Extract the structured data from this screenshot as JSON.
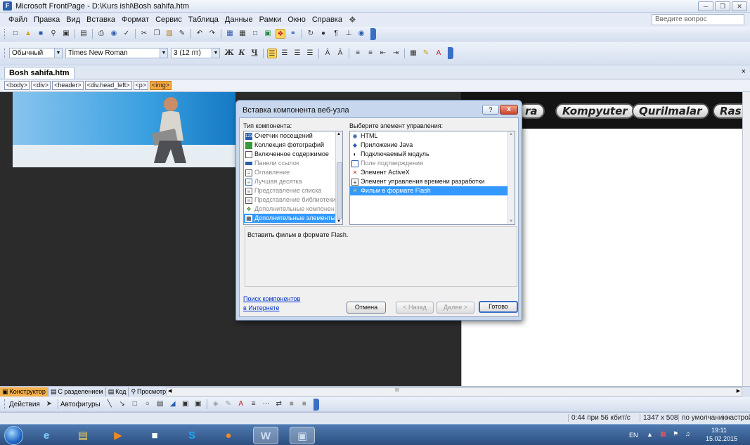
{
  "window": {
    "title": "Microsoft FrontPage - D:\\Kurs ishi\\Bosh sahifa.htm",
    "app_icon": "frontpage-icon",
    "buttons": [
      "minimize-icon",
      "restore-icon",
      "close-icon"
    ]
  },
  "menu": {
    "items": [
      "Файл",
      "Правка",
      "Вид",
      "Вставка",
      "Формат",
      "Сервис",
      "Таблица",
      "Данные",
      "Рамки",
      "Окно",
      "Справка"
    ],
    "ask_placeholder": "Введите вопрос"
  },
  "format_toolbar": {
    "style": "Обычный",
    "font": "Times New Roman",
    "size": "3 (12 пт)",
    "bold": "Ж",
    "italic": "К",
    "underline": "Ч"
  },
  "document": {
    "tab": "Bosh sahifa.htm",
    "close": "×"
  },
  "tags": [
    "<body>",
    "<div>",
    "<header>",
    "<div.head_left>",
    "<p>",
    "<img>"
  ],
  "page": {
    "nav": [
      "ra",
      "Kompyuter",
      "Qurilmalar",
      "Ras"
    ]
  },
  "dialog": {
    "title": "Вставка компонента веб-узла",
    "help": "?",
    "close": "x",
    "type_label": "Тип компонента:",
    "type_items": [
      {
        "label": "Счетчик посещений",
        "icon": "counter-icon",
        "state": "normal"
      },
      {
        "label": "Коллекция фотографий",
        "icon": "photo-gallery-icon",
        "state": "normal"
      },
      {
        "label": "Включенное содержимое",
        "icon": "included-content-icon",
        "state": "normal"
      },
      {
        "label": "Панели ссылок",
        "icon": "link-bar-icon",
        "state": "gray"
      },
      {
        "label": "Оглавление",
        "icon": "toc-icon",
        "state": "gray"
      },
      {
        "label": "Лучшая десятка",
        "icon": "top-ten-icon",
        "state": "gray"
      },
      {
        "label": "Представление списка",
        "icon": "list-view-icon",
        "state": "gray"
      },
      {
        "label": "Представление библиотеки",
        "icon": "library-view-icon",
        "state": "gray"
      },
      {
        "label": "Дополнительные компонен",
        "icon": "additional-components-icon",
        "state": "gray"
      },
      {
        "label": "Дополнительные элементы",
        "icon": "advanced-controls-icon",
        "state": "selected"
      }
    ],
    "control_label": "Выберите элемент управления:",
    "control_items": [
      {
        "label": "HTML",
        "icon": "html-icon",
        "state": "normal"
      },
      {
        "label": "Приложение Java",
        "icon": "java-icon",
        "state": "normal"
      },
      {
        "label": "Подключаемый модуль",
        "icon": "plugin-icon",
        "state": "normal"
      },
      {
        "label": "Поле подтверждения",
        "icon": "confirmation-field-icon",
        "state": "gray"
      },
      {
        "label": "Элемент ActiveX",
        "icon": "activex-icon",
        "state": "normal"
      },
      {
        "label": "Элемент управления времени разработки",
        "icon": "design-time-control-icon",
        "state": "normal"
      },
      {
        "label": "Фильм в формате Flash",
        "icon": "flash-icon",
        "state": "selected"
      }
    ],
    "description": "Вставить фильм в формате Flash.",
    "search_link_line1": "Поиск компонентов",
    "search_link_line2": "в Интернете",
    "cancel": "Отмена",
    "back": "< Назад",
    "next": "Далее >",
    "finish": "Готово"
  },
  "view_tabs": [
    {
      "label": "Конструктор",
      "icon": "design-view-icon",
      "active": true
    },
    {
      "label": "С разделением",
      "icon": "split-view-icon",
      "active": false
    },
    {
      "label": "Код",
      "icon": "code-view-icon",
      "active": false
    },
    {
      "label": "Просмотр",
      "icon": "preview-icon",
      "active": false
    }
  ],
  "scroll_mark": "III",
  "drawing_toolbar": {
    "actions": "Действия",
    "autoshapes": "Автофигуры"
  },
  "status": {
    "download": "0:44 при 56 кбит/с",
    "dimensions": "1347 x 508",
    "mode": "по умолчанию",
    "settings": "настройка"
  },
  "taskbar": {
    "apps": [
      "ie-icon",
      "explorer-icon",
      "media-player-icon",
      "save-icon",
      "skype-icon",
      "firefox-icon",
      "word-icon",
      "frontpage-icon"
    ],
    "lang": "EN",
    "time": "19:11",
    "date": "15.02.2015"
  }
}
